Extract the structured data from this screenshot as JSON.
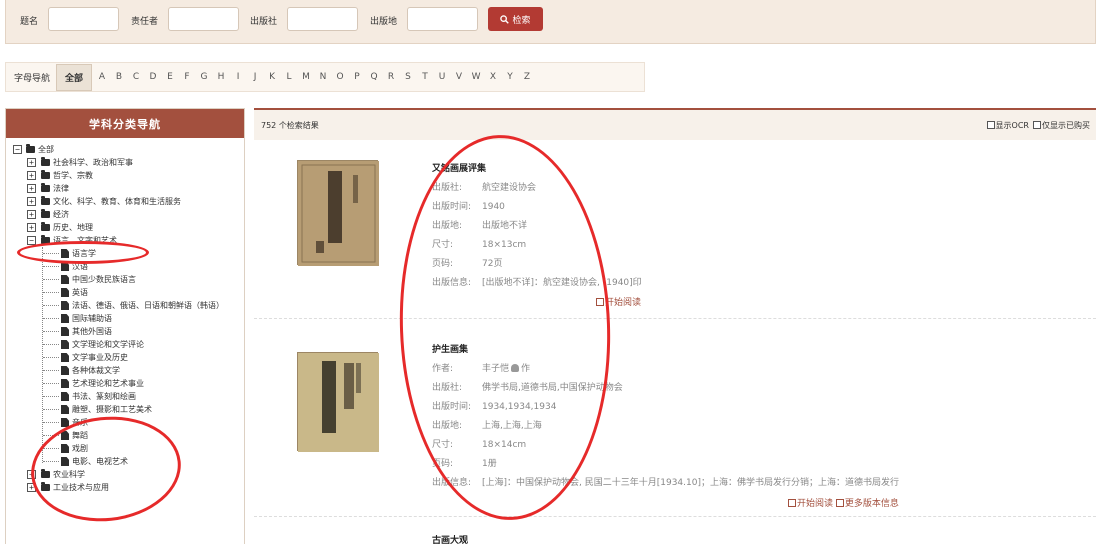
{
  "search": {
    "fields": [
      {
        "label": "题名",
        "value": ""
      },
      {
        "label": "责任者",
        "value": ""
      },
      {
        "label": "出版社",
        "value": ""
      },
      {
        "label": "出版地",
        "value": ""
      }
    ],
    "button_label": "检索"
  },
  "letter_nav": {
    "label": "字母导航",
    "all_label": "全部",
    "letters": [
      "A",
      "B",
      "C",
      "D",
      "E",
      "F",
      "G",
      "H",
      "I",
      "J",
      "K",
      "L",
      "M",
      "N",
      "O",
      "P",
      "Q",
      "R",
      "S",
      "T",
      "U",
      "V",
      "W",
      "X",
      "Y",
      "Z"
    ]
  },
  "category_nav": {
    "title": "学科分类导航",
    "root": "全部",
    "top_level": [
      "社会科学、政治和军事",
      "哲学、宗教",
      "法律",
      "文化、科学、教育、体育和生活服务",
      "经济",
      "历史、地理",
      "语言、文字和艺术"
    ],
    "sub_items": [
      "语言学",
      "汉语",
      "中国少数民族语言",
      "英语",
      "法语、德语、俄语、日语和朝鲜语（韩语）",
      "国际辅助语",
      "其他外国语",
      "文学理论和文学评论",
      "文学事业及历史",
      "各种体裁文学",
      "艺术理论和艺术事业",
      "书法、篆刻和绘画",
      "雕塑、摄影和工艺美术",
      "音乐",
      "舞蹈",
      "戏剧",
      "电影、电视艺术"
    ],
    "bottom_level": [
      "农业科学",
      "工业技术与应用"
    ]
  },
  "results": {
    "count_text": "752 个检索结果",
    "opt_ocr": "显示OCR",
    "opt_purchased": "仅显示已购买",
    "items": [
      {
        "title": "又铭画展评集",
        "fields": [
          {
            "label": "出版社:",
            "value": "航空建设协会"
          },
          {
            "label": "出版时间:",
            "value": "1940"
          },
          {
            "label": "出版地:",
            "value": "出版地不详"
          },
          {
            "label": "尺寸:",
            "value": "18×13cm"
          },
          {
            "label": "页码:",
            "value": "72页"
          },
          {
            "label": "出版信息:",
            "value": "[出版地不详]：航空建设协会, [1940]印"
          }
        ],
        "read_label": "开始阅读"
      },
      {
        "title": "护生画集",
        "fields": [
          {
            "label": "作者:",
            "value": "丰子恺",
            "suffix": "作"
          },
          {
            "label": "出版社:",
            "value": "佛学书局,道德书局,中国保护动物会"
          },
          {
            "label": "出版时间:",
            "value": "1934,1934,1934"
          },
          {
            "label": "出版地:",
            "value": "上海,上海,上海"
          },
          {
            "label": "尺寸:",
            "value": "18×14cm"
          },
          {
            "label": "页码:",
            "value": "1册"
          },
          {
            "label": "出版信息:",
            "value": "[上海]：中国保护动物会, 民国二十三年十月[1934.10]；上海：佛学书局发行分销；上海：道德书局发行"
          }
        ],
        "read_label": "开始阅读",
        "more_label": "更多版本信息"
      },
      {
        "title": "古画大观"
      }
    ]
  },
  "colors": {
    "accent": "#a3503e",
    "search_button": "#b33a33",
    "annotation": "#e62a2a"
  }
}
